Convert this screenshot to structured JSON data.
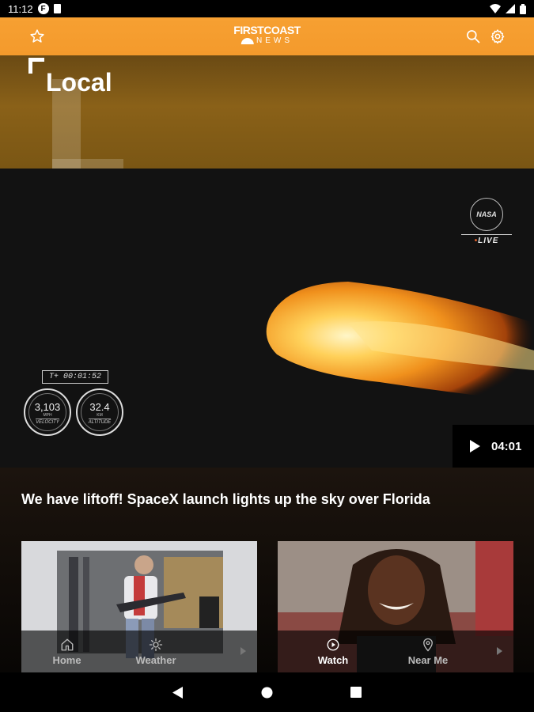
{
  "status_bar": {
    "time": "11:12",
    "notif_letter": "F"
  },
  "app_bar": {
    "logo_top": "FIRSTCOAST",
    "logo_bottom": "NEWS",
    "icons": [
      "star-icon",
      "search-icon",
      "gear-icon"
    ],
    "background": "#f7a032"
  },
  "section": {
    "title": "Local"
  },
  "video": {
    "overlay": {
      "nasa_logo": "NASA",
      "live_label": "LIVE",
      "timer": "T+ 00:01:52",
      "velocity": {
        "value": "3,103",
        "unit": "MPH",
        "label": "VELOCITY"
      },
      "altitude": {
        "value": "32.4",
        "unit": "KM",
        "label": "ALTITUDE"
      }
    },
    "duration": "04:01"
  },
  "headline": "We have liftoff! SpaceX launch lights up the sky over Florida",
  "bottom_nav": {
    "items": [
      {
        "label": "Home",
        "icon": "home-icon",
        "active": false
      },
      {
        "label": "Weather",
        "icon": "sun-icon",
        "active": false
      },
      {
        "label": "Watch",
        "icon": "play-circle-icon",
        "active": true
      },
      {
        "label": "Near Me",
        "icon": "location-pin-icon",
        "active": false
      }
    ]
  },
  "system_nav": {
    "icons": [
      "back-icon",
      "home-circle-icon",
      "recents-icon"
    ]
  }
}
